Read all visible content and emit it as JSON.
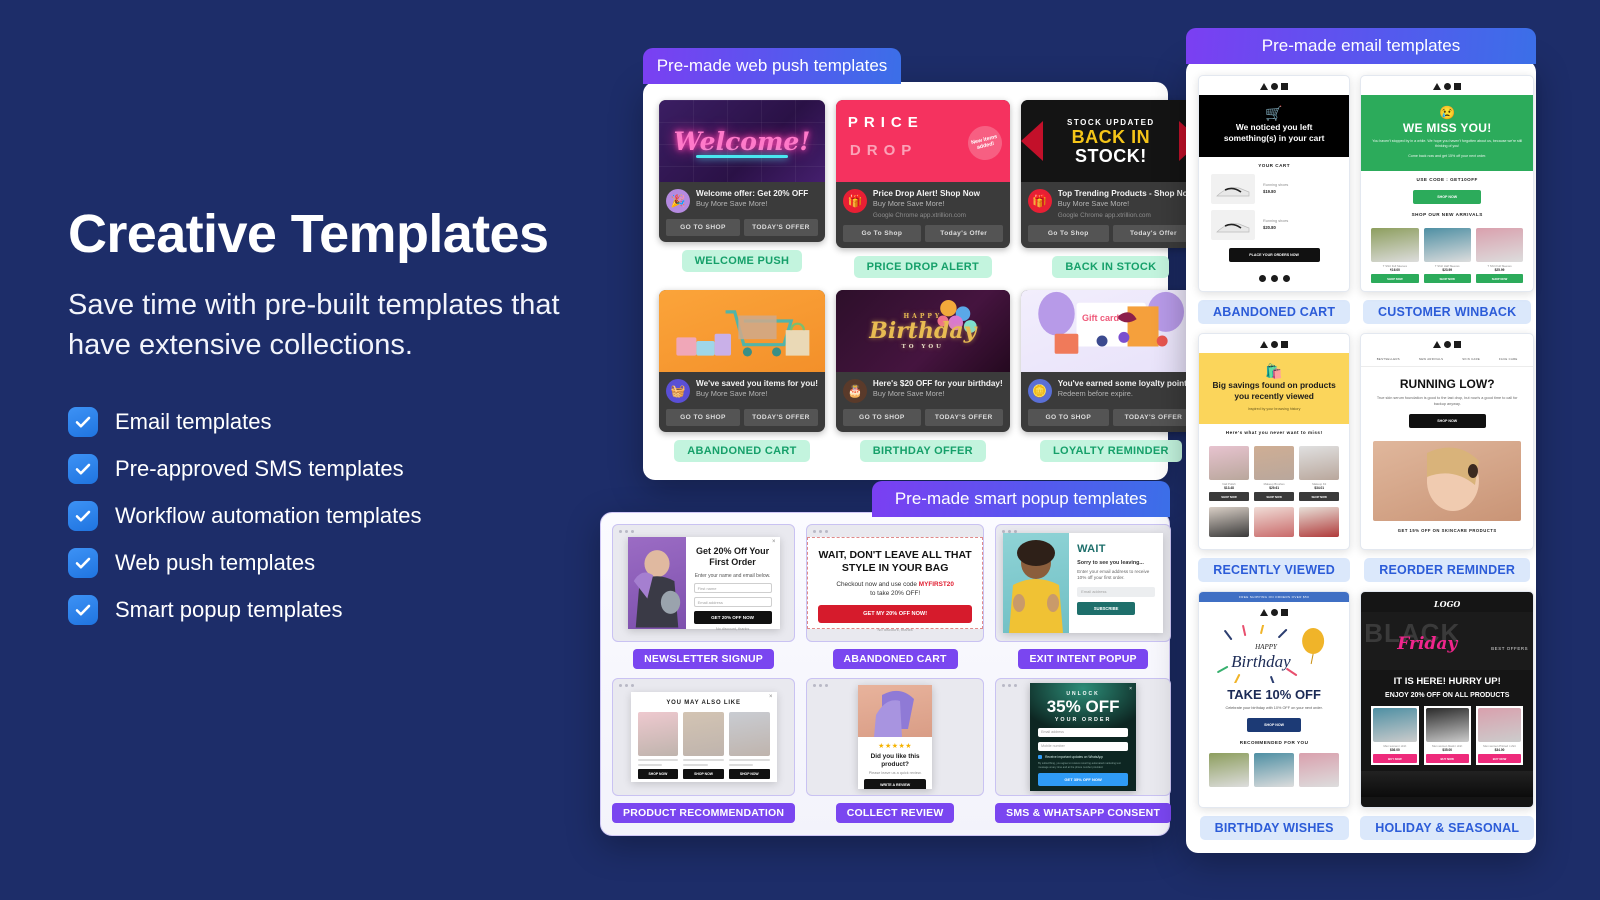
{
  "hero": {
    "title": "Creative Templates",
    "subtitle": "Save time with pre-built templates that have extensive collections.",
    "features": [
      "Email templates",
      "Pre-approved SMS templates",
      "Workflow automation templates",
      "Web push templates",
      "Smart popup templates"
    ]
  },
  "colors": {
    "background": "#1d2d69",
    "tab_gradient_start": "#7b3ff2",
    "tab_gradient_end": "#3b6fe8",
    "badge_green_bg": "#c3f4de",
    "badge_green_text": "#16a06a",
    "badge_purple_bg": "#7a46f0",
    "badge_blue_bg": "#dbe8fb",
    "badge_blue_text": "#2c5cd8",
    "checkbox": "#2e86f0"
  },
  "webpush": {
    "tab_label": "Pre-made web push templates",
    "cards": [
      {
        "badge": "WELCOME PUSH",
        "hero_text": "Welcome!",
        "title": "Welcome offer: Get 20% OFF",
        "subtitle": "Buy More Save More!",
        "source": "",
        "btn1": "GO TO SHOP",
        "btn2": "TODAY'S OFFER",
        "avatar_icon": "party-popper-icon"
      },
      {
        "badge": "PRICE DROP ALERT",
        "hero_line1": "PRICE",
        "hero_line2": "DROP",
        "hero_badge": "New items added!",
        "title": "Price Drop Alert! Shop Now",
        "subtitle": "Buy More Save More!",
        "source": "Google Chrome   app.xtrillion.com",
        "btn1": "Go To Shop",
        "btn2": "Today's Offer",
        "avatar_icon": "gift-icon"
      },
      {
        "badge": "BACK IN STOCK",
        "hero_line1": "STOCK UPDATED",
        "hero_line2": "BACK IN",
        "hero_line3": "STOCK!",
        "title": "Top Trending Products - Shop Now",
        "subtitle": "Buy More Save More!",
        "source": "Google Chrome   app.xtrillion.com",
        "btn1": "Go To Shop",
        "btn2": "Today's Offer",
        "avatar_icon": "gift-icon"
      },
      {
        "badge": "ABANDONED CART",
        "title": "We've saved you items for you!",
        "subtitle": "Buy More Save More!",
        "btn1": "GO TO SHOP",
        "btn2": "TODAY'S OFFER",
        "avatar_icon": "shopping-basket-icon"
      },
      {
        "badge": "BIRTHDAY OFFER",
        "hero_line1": "HAPPY",
        "hero_line2": "Birthday",
        "hero_line3": "TO YOU",
        "title": "Here's $20 OFF for your birthday!",
        "subtitle": "Buy More Save More!",
        "btn1": "GO TO SHOP",
        "btn2": "TODAY'S OFFER",
        "avatar_icon": "cake-icon"
      },
      {
        "badge": "LOYALTY REMINDER",
        "hero_text": "Gift card",
        "title": "You've earned some loyalty points",
        "subtitle": "Redeem before expire.",
        "btn1": "GO TO SHOP",
        "btn2": "TODAY'S OFFER",
        "avatar_icon": "coins-icon"
      }
    ]
  },
  "popup": {
    "tab_label": "Pre-made smart popup templates",
    "cards": [
      {
        "badge": "NEWSLETTER SIGNUP",
        "heading": "Get 20% Off Your First Order",
        "sub": "Enter your name and email below.",
        "input1": "First name",
        "input2": "Email address",
        "cta": "GET 20% OFF NOW",
        "decline": "No discount, thanks"
      },
      {
        "badge": "ABANDONED CART",
        "heading": "WAIT, DON'T LEAVE ALL THAT STYLE IN YOUR BAG",
        "sub_pre": "Checkout now and use code ",
        "code": "MYFIRST20",
        "sub_post": "to take 20% OFF!",
        "cta": "GET MY 20% OFF NOW!",
        "decline": "No discount, thanks"
      },
      {
        "badge": "EXIT INTENT POPUP",
        "heading": "WAIT",
        "sub": "Sorry to see you leaving...",
        "para": "Enter your email address to receive 10% off your first order.",
        "input1": "Email address",
        "cta": "SUBSCRIBE"
      },
      {
        "badge": "PRODUCT RECOMMENDATION",
        "heading": "YOU MAY ALSO LIKE",
        "cta": "SHOP NOW"
      },
      {
        "badge": "COLLECT REVIEW",
        "stars": "★★★★★",
        "heading": "Did you like this product?",
        "sub": "Please leave us a quick review.",
        "cta": "WRITE A REVIEW"
      },
      {
        "badge": "SMS & WHATSAPP CONSENT",
        "unlock": "UNLOCK",
        "discount": "35% OFF",
        "order": "YOUR ORDER",
        "input1": "Email address",
        "input2": "Mobile number",
        "consent": "Receive important updates on WhatsApp",
        "legal": "By subscribing, you agree to receive recurring automated marketing text message at any time and at the phone number provided.",
        "cta": "GET 35% OFF NOW"
      }
    ]
  },
  "email": {
    "tab_label": "Pre-made email templates",
    "cards": [
      {
        "badge": "ABANDONED CART",
        "hero_title": "We noticed you left something(s) in your cart",
        "section": "YOUR CART",
        "items": [
          {
            "name": "Running shoes",
            "price": "$19.80"
          },
          {
            "name": "Running shoes",
            "price": "$20.80"
          }
        ],
        "cta": "PLACE YOUR ORDERS NOW"
      },
      {
        "badge": "CUSTOMER WINBACK",
        "hero_title": "WE MISS YOU!",
        "hero_para": "You haven't stopped by in a while. We hope you haven't forgotten about us, because we're still thinking of you!",
        "hero_para2": "Come back now and get 15% off your next order.",
        "code_label": "USE CODE : GET10OFF",
        "cta": "SHOP NOW",
        "section": "SHOP OUR NEW ARRIVALS",
        "products": [
          {
            "name": "T Shirt Full Sleeves",
            "price": "₹16.00",
            "cta": "SHOP NOW"
          },
          {
            "name": "T Shirt Half Sleeves",
            "price": "$23.99",
            "cta": "SHOP NOW"
          },
          {
            "name": "T Shirt Full Sleeves",
            "price": "$25.99",
            "cta": "SHOP NOW"
          }
        ]
      },
      {
        "badge": "RECENTLY VIEWED",
        "hero_title": "Big savings found on products you recently viewed",
        "hero_sub": "Inspired by your browsing history",
        "section": "Here's what you never want to miss!",
        "products": [
          {
            "name": "Nail Polish",
            "price": "$13.48",
            "cta": "SHOP NOW"
          },
          {
            "name": "Makeup Brushes",
            "price": "$29.61",
            "cta": "SHOP NOW"
          },
          {
            "name": "Makeup Kit",
            "price": "$34.01",
            "cta": "SHOP NOW"
          }
        ]
      },
      {
        "badge": "REORDER REMINDER",
        "nav": [
          "BESTSELLERS",
          "NEW ARRIVALS",
          "SKIN CARE",
          "FACE CARE"
        ],
        "hero_title": "RUNNING LOW?",
        "hero_para": "True skin serum foundation is good to the last drop, but now's a good time to call for backup anyway.",
        "cta": "SHOP NOW",
        "footer": "GET 15% OFF ON SKINCARE PRODUCTS"
      },
      {
        "badge": "BIRTHDAY WISHES",
        "topbar": "FREE SHIPPING ON ORDERS OVER $50",
        "hero_script": "HAPPY Birthday",
        "hero_title": "TAKE 10% OFF",
        "hero_para": "Celebrate your birthday with 10% OFF on your next order.",
        "cta": "SHOP NOW",
        "section": "RECOMMENDED FOR YOU"
      },
      {
        "badge": "HOLIDAY & SEASONAL",
        "logo": "LOGO",
        "hero_big": "BLACK",
        "hero_script": "Friday",
        "hero_small": "BEST OFFERS",
        "hero_title": "IT IS HERE! HURRY UP!",
        "hero_sub": "ENJOY 20% OFF ON ALL PRODUCTS",
        "products": [
          {
            "name": "Men women t shirt",
            "price": "$36.00",
            "cta": "BUY NOW"
          },
          {
            "name": "Men women black t shirt",
            "price": "$35.00",
            "cta": "BUY NOW"
          },
          {
            "name": "Men women Printed t shirt",
            "price": "$34.00",
            "cta": "BUY NOW"
          }
        ]
      }
    ]
  }
}
